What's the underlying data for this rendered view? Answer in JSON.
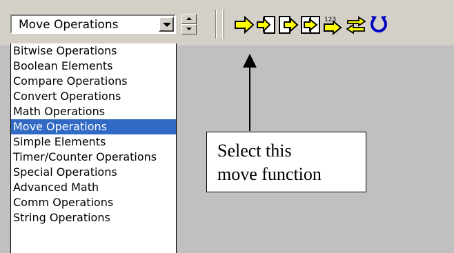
{
  "combo": {
    "selected": "Move Operations"
  },
  "toolbar": {
    "buttons": [
      {
        "name": "move-icon",
        "label": "Move"
      },
      {
        "name": "move-into-icon",
        "label": "Move Into"
      },
      {
        "name": "move-out-icon",
        "label": "Move Out"
      },
      {
        "name": "move-block-icon",
        "label": "Block Move"
      },
      {
        "name": "move-numeric-icon",
        "label": "Move Numeric",
        "text": "123"
      },
      {
        "name": "swap-icon",
        "label": "Swap"
      },
      {
        "name": "rotate-icon",
        "label": "Rotate"
      }
    ]
  },
  "dropdown": {
    "items": [
      "Bitwise Operations",
      "Boolean Elements",
      "Compare Operations",
      "Convert Operations",
      "Math Operations",
      "Move Operations",
      "Simple Elements",
      "Timer/Counter Operations",
      "Special Operations",
      "Advanced Math",
      "Comm Operations",
      "String Operations"
    ],
    "selected_index": 5
  },
  "callout": {
    "line1": "Select this",
    "line2": "move function"
  },
  "colors": {
    "selection": "#316ac5",
    "icon_fill": "#ffff00",
    "rotate_blue": "#0000c0"
  }
}
